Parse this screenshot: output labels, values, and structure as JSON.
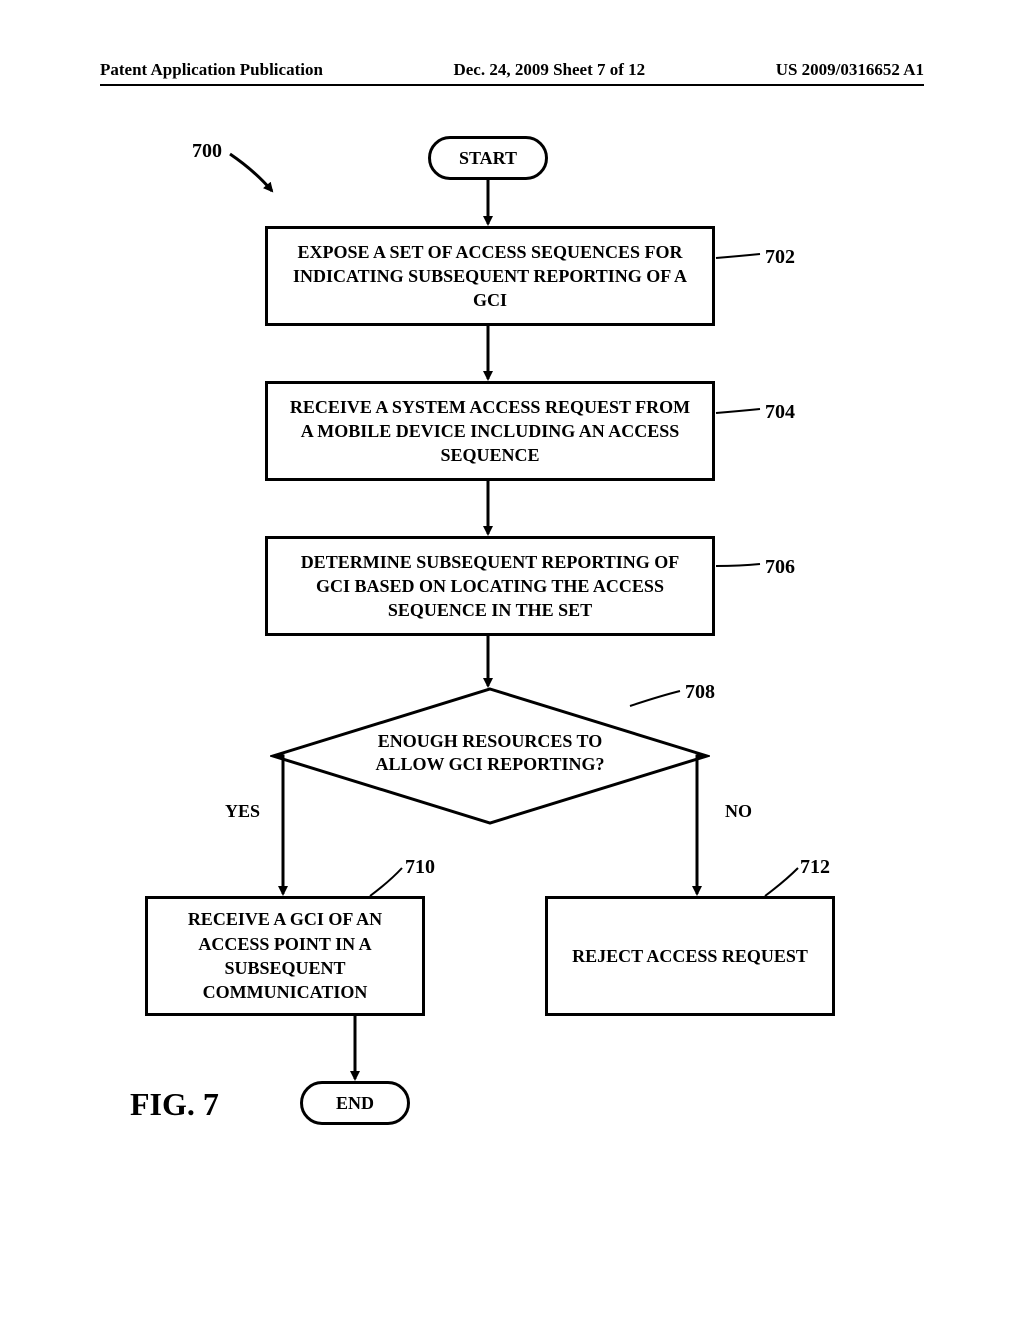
{
  "header": {
    "left": "Patent Application Publication",
    "center": "Dec. 24, 2009  Sheet 7 of 12",
    "right": "US 2009/0316652 A1"
  },
  "labels": {
    "ref700": "700",
    "ref702": "702",
    "ref704": "704",
    "ref706": "706",
    "ref708": "708",
    "ref710": "710",
    "ref712": "712",
    "yes": "YES",
    "no": "NO"
  },
  "nodes": {
    "start": "START",
    "step702": "EXPOSE A SET OF ACCESS SEQUENCES FOR INDICATING SUBSEQUENT REPORTING OF A GCI",
    "step704": "RECEIVE A SYSTEM ACCESS REQUEST FROM A MOBILE DEVICE INCLUDING AN ACCESS SEQUENCE",
    "step706": "DETERMINE SUBSEQUENT REPORTING OF GCI BASED ON LOCATING THE ACCESS SEQUENCE IN THE SET",
    "decision708": "ENOUGH RESOURCES TO ALLOW GCI REPORTING?",
    "step710": "RECEIVE A GCI OF AN ACCESS POINT IN A SUBSEQUENT COMMUNICATION",
    "step712": "REJECT ACCESS REQUEST",
    "end": "END"
  },
  "figure": "FIG. 7"
}
